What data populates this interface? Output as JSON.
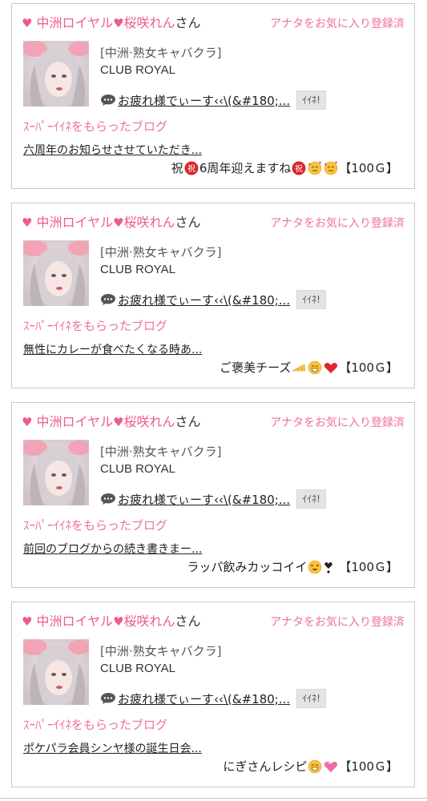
{
  "colors": {
    "accent_pink": "#ee5a8f",
    "link_pink": "#ee6fa0",
    "border": "#c9c9c9",
    "button_bg": "#e4e4e4"
  },
  "icons": [
    "heart-icon",
    "speech-bubble-icon"
  ],
  "posts": [
    {
      "heart": "♥",
      "store": "中洲ロイヤル",
      "name": "桜咲れん",
      "honorific": "さん",
      "favorite_label": "アナタをお気に入り登録済",
      "store_type": "[中洲·熟女キャバクラ]",
      "club_name": "CLUB ROYAL",
      "message": "お疲れ様でぃーす‹‹\\(&#180;...",
      "like_button": "ｲｲﾈ!",
      "super_label": "ｽｰﾊﾟｰｲｲﾈをもらったブログ",
      "blog_title": "六周年のお知らせさせていただき...",
      "gift_text_before": "祝",
      "gift_text": "6周年迎えますね",
      "gift_emojis": [
        "congrats-icon",
        "smiling-hearts-icon",
        "smiling-hearts-icon"
      ],
      "gift_amount": "【100Ｇ】"
    },
    {
      "heart": "♥",
      "store": "中洲ロイヤル",
      "name": "桜咲れん",
      "honorific": "さん",
      "favorite_label": "アナタをお気に入り登録済",
      "store_type": "[中洲·熟女キャバクラ]",
      "club_name": "CLUB ROYAL",
      "message": "お疲れ様でぃーす‹‹\\(&#180;...",
      "like_button": "ｲｲﾈ!",
      "super_label": "ｽｰﾊﾟｰｲｲﾈをもらったブログ",
      "blog_title": "無性にカレーが食べたくなる時あ...",
      "gift_text_before": "",
      "gift_text": "ご褒美チーズ",
      "gift_emojis": [
        "cheese-icon",
        "grin-icon",
        "red-heart-icon"
      ],
      "gift_amount": "【100Ｇ】"
    },
    {
      "heart": "♥",
      "store": "中洲ロイヤル",
      "name": "桜咲れん",
      "honorific": "さん",
      "favorite_label": "アナタをお気に入り登録済",
      "store_type": "[中洲·熟女キャバクラ]",
      "club_name": "CLUB ROYAL",
      "message": "お疲れ様でぃーす‹‹\\(&#180;...",
      "like_button": "ｲｲﾈ!",
      "super_label": "ｽｰﾊﾟｰｲｲﾈをもらったブログ",
      "blog_title": "前回のブログからの続き書きまー...",
      "gift_text_before": "",
      "gift_text": "ラッパ飲みカッコイイ",
      "gift_emojis": [
        "heart-eyes-icon",
        "heart-exclamation-icon"
      ],
      "gift_amount": "【100Ｇ】"
    },
    {
      "heart": "♥",
      "store": "中洲ロイヤル",
      "name": "桜咲れん",
      "honorific": "さん",
      "favorite_label": "アナタをお気に入り登録済",
      "store_type": "[中洲·熟女キャバクラ]",
      "club_name": "CLUB ROYAL",
      "message": "お疲れ様でぃーす‹‹\\(&#180;...",
      "like_button": "ｲｲﾈ!",
      "super_label": "ｽｰﾊﾟｰｲｲﾈをもらったブログ",
      "blog_title": "ポケパラ会員シンヤ様の誕生日会...",
      "gift_text_before": "",
      "gift_text": "にぎさんレシピ",
      "gift_emojis": [
        "grin-icon",
        "pink-heart-icon"
      ],
      "gift_amount": "【100Ｇ】"
    }
  ]
}
